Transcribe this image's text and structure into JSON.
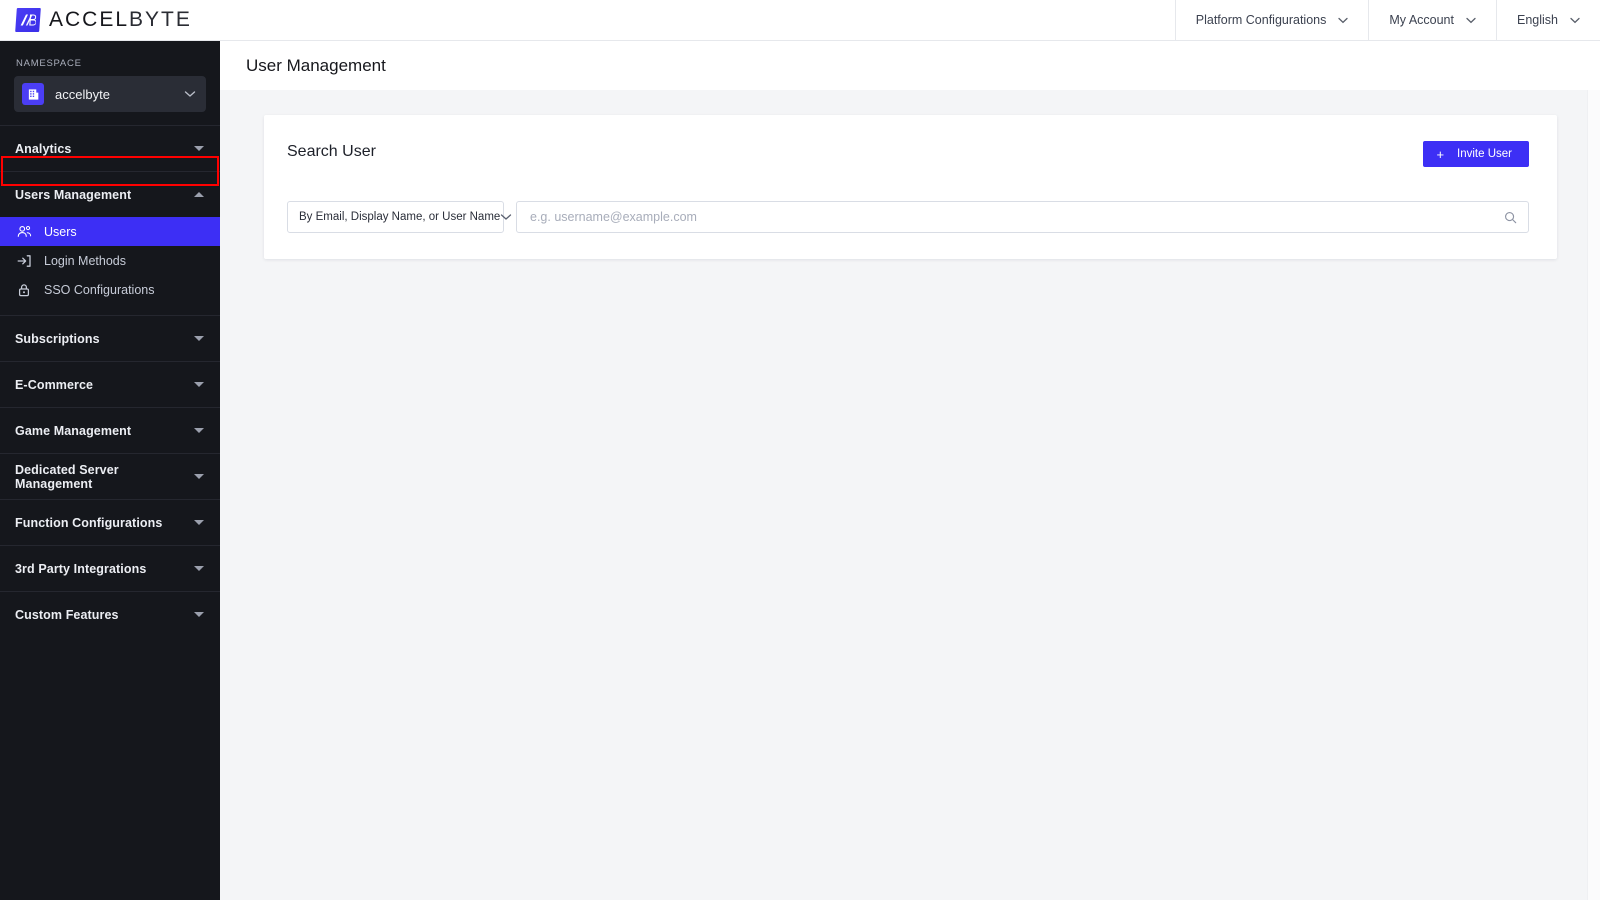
{
  "topbar": {
    "logo_icon": "accelbyte-logo-icon",
    "brand_bold": "ACCEL",
    "brand_light": "BYTE",
    "nav": [
      {
        "label": "Platform Configurations",
        "icon": "chevron-down-icon"
      },
      {
        "label": "My Account",
        "icon": "chevron-down-icon"
      },
      {
        "label": "English",
        "icon": "chevron-down-icon"
      }
    ]
  },
  "sidebar": {
    "namespace_label": "NAMESPACE",
    "namespace_value": "accelbyte",
    "namespace_icon": "building-icon",
    "namespace_caret": "chevron-down-icon",
    "groups": [
      {
        "label": "Analytics",
        "expanded": false,
        "caret": "chevron-down-icon",
        "items": []
      },
      {
        "label": "Users Management",
        "expanded": true,
        "caret": "chevron-up-icon",
        "items": [
          {
            "label": "Users",
            "icon": "users-icon",
            "active": true
          },
          {
            "label": "Login Methods",
            "icon": "login-icon",
            "active": false
          },
          {
            "label": "SSO Configurations",
            "icon": "lock-icon",
            "active": false
          }
        ]
      },
      {
        "label": "Subscriptions",
        "expanded": false,
        "caret": "chevron-down-icon",
        "items": []
      },
      {
        "label": "E-Commerce",
        "expanded": false,
        "caret": "chevron-down-icon",
        "items": []
      },
      {
        "label": "Game Management",
        "expanded": false,
        "caret": "chevron-down-icon",
        "items": []
      },
      {
        "label": "Dedicated Server Management",
        "expanded": false,
        "caret": "chevron-down-icon",
        "items": []
      },
      {
        "label": "Function Configurations",
        "expanded": false,
        "caret": "chevron-down-icon",
        "items": []
      },
      {
        "label": "3rd Party Integrations",
        "expanded": false,
        "caret": "chevron-down-icon",
        "items": []
      },
      {
        "label": "Custom Features",
        "expanded": false,
        "caret": "chevron-down-icon",
        "items": []
      }
    ]
  },
  "page": {
    "title": "User Management"
  },
  "card": {
    "title": "Search User",
    "invite_button": {
      "label": "Invite User",
      "icon": "plus-icon"
    },
    "filter_select": {
      "value": "By Email, Display Name, or User Name",
      "icon": "chevron-down-icon"
    },
    "search_input": {
      "value": "",
      "placeholder": "e.g. username@example.com",
      "icon": "search-icon"
    }
  },
  "colors": {
    "accent": "#3d2ff5",
    "sidebar_bg": "#15171c",
    "page_bg": "#f4f5f7",
    "highlight_border": "#ff0000"
  }
}
